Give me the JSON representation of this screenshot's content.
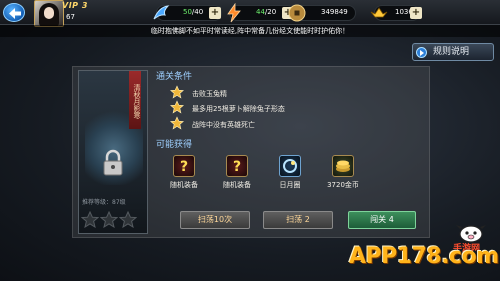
{
  "topbar": {
    "vip": "VIP 3",
    "level": "67",
    "stamina": {
      "current": "50",
      "max": "/40"
    },
    "energy": {
      "current": "44",
      "max": "/20"
    },
    "coins": "349849",
    "gold": "1036",
    "plus": "+"
  },
  "notice": "临时抱佛脚不如平时常读经,阵中常备几份经文使能时时护佑你！",
  "rules_button": "规则说明",
  "stage": {
    "name": "清秋月影寒",
    "recommended": "推荐等级：87级"
  },
  "conditions_title": "通关条件",
  "conditions": [
    "击败玉兔精",
    "最多用25根萝卜解除兔子形态",
    "战阵中没有英雄死亡"
  ],
  "rewards_title": "可能获得",
  "rewards": [
    {
      "label": "随机装备",
      "icon": "random-equipment-icon"
    },
    {
      "label": "随机装备",
      "icon": "random-equipment-icon"
    },
    {
      "label": "日月圈",
      "icon": "sun-moon-ring-icon"
    },
    {
      "label": "3720金币",
      "icon": "gold-coins-icon"
    }
  ],
  "actions": {
    "sweep10": "扫荡10次",
    "sweep": "扫荡 2",
    "challenge": "闯关 4"
  },
  "watermark": {
    "main": "APP178.com",
    "sub": "手游网"
  },
  "colors": {
    "accent_blue": "#9fd0ff",
    "gold": "#ffb31a",
    "green_btn": "#3d8f5c"
  }
}
